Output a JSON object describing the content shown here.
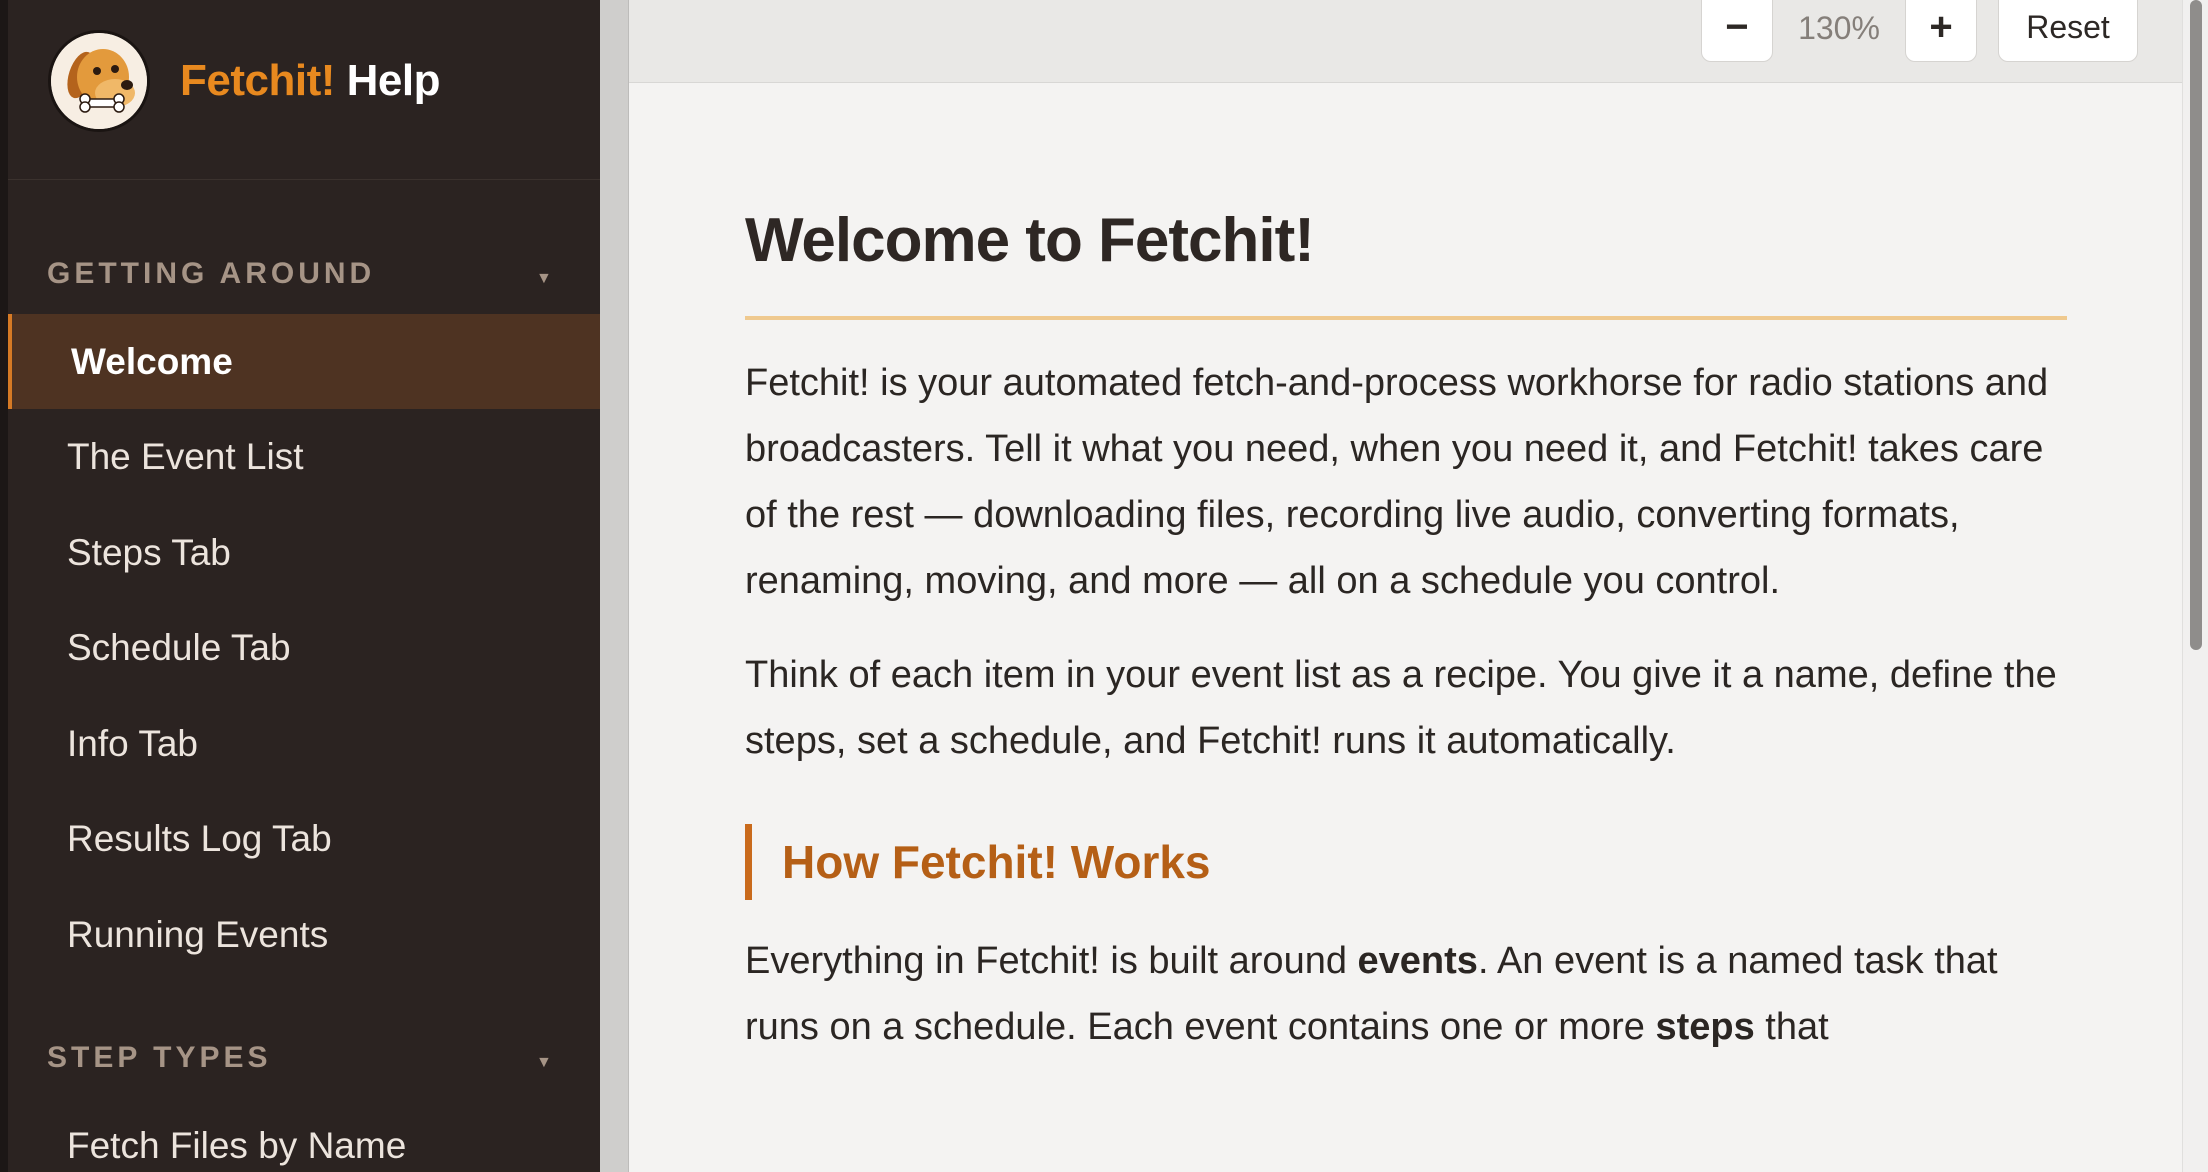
{
  "brand": {
    "name_accent": "Fetchit!",
    "name_rest": "Help"
  },
  "sidebar": {
    "sections": [
      {
        "label": "GETTING AROUND",
        "caret": "▼",
        "items": [
          {
            "label": "Welcome",
            "active": true
          },
          {
            "label": "The Event List"
          },
          {
            "label": "Steps Tab"
          },
          {
            "label": "Schedule Tab"
          },
          {
            "label": "Info Tab"
          },
          {
            "label": "Results Log Tab"
          },
          {
            "label": "Running Events"
          }
        ]
      },
      {
        "label": "STEP TYPES",
        "caret": "▼",
        "items": [
          {
            "label": "Fetch Files by Name"
          }
        ]
      }
    ]
  },
  "toolbar": {
    "zoom_out": "−",
    "zoom_level": "130%",
    "zoom_in": "+",
    "reset": "Reset"
  },
  "content": {
    "title": "Welcome to Fetchit!",
    "intro_1": "Fetchit! is your automated fetch-and-process workhorse for radio stations and broadcasters. Tell it what you need, when you need it, and Fetchit! takes care of the rest — downloading files, recording live audio, converting formats, renaming, moving, and more — all on a schedule you control.",
    "intro_2": "Think of each item in your event list as a recipe. You give it a name, define the steps, set a schedule, and Fetchit! runs it automatically.",
    "section_heading": "How Fetchit! Works",
    "body_1a": "Everything in Fetchit! is built around ",
    "body_1b": "events",
    "body_1c": ". An event is a named task that runs on a schedule. Each event contains one or more ",
    "body_1d": "steps",
    "body_1e": " that"
  },
  "colors": {
    "sidebar_bg": "#2b2321",
    "active_bg": "#4e3322",
    "accent_orange": "#e8891f",
    "heading_orange": "#b55f16",
    "title_rule": "#efc98f"
  }
}
